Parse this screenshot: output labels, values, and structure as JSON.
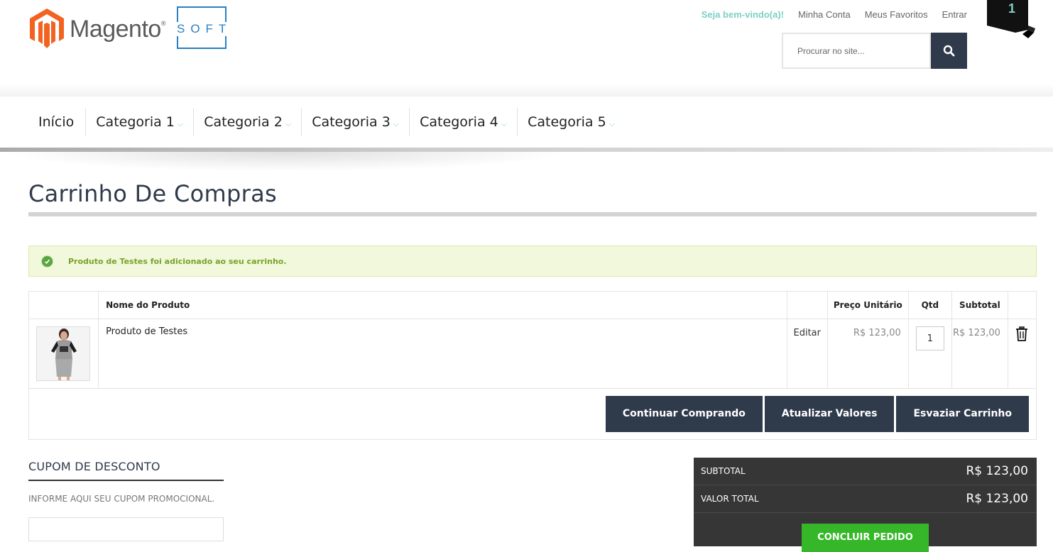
{
  "header": {
    "logo_text": "Magento",
    "logo_suffix": "SOFT",
    "welcome": "Seja bem-vindo(a)!",
    "links": [
      "Minha Conta",
      "Meus Favoritos",
      "Entrar"
    ],
    "cart_count": "1",
    "search_placeholder": "Procurar no site...",
    "colors": {
      "accent": "#7dd0c6",
      "dark": "#2f3a4b",
      "logo_orange": "#f26322",
      "soft_blue": "#2a7fc0"
    }
  },
  "nav": {
    "items": [
      "Início",
      "Categoria 1",
      "Categoria 2",
      "Categoria 3",
      "Categoria 4",
      "Categoria 5"
    ]
  },
  "page": {
    "title": "Carrinho De Compras"
  },
  "message": {
    "text": "Produto de Testes foi adicionado ao seu carrinho."
  },
  "cart": {
    "headers": {
      "name": "Nome do Produto",
      "price": "Preço Unitário",
      "qty": "Qtd",
      "subtotal": "Subtotal"
    },
    "items": [
      {
        "name": "Produto de Testes",
        "edit": "Editar",
        "price": "R$ 123,00",
        "qty": "1",
        "subtotal": "R$ 123,00"
      }
    ],
    "buttons": {
      "continue": "Continuar Comprando",
      "update": "Atualizar Valores",
      "clear": "Esvaziar Carrinho"
    }
  },
  "coupon": {
    "title": "CUPOM DE DESCONTO",
    "hint": "INFORME AQUI SEU CUPOM PROMOCIONAL."
  },
  "totals": {
    "subtotal_label": "SUBTOTAL",
    "subtotal_value": "R$ 123,00",
    "total_label": "VALOR TOTAL",
    "total_value": "R$ 123,00",
    "checkout": "CONCLUIR PEDIDO"
  }
}
